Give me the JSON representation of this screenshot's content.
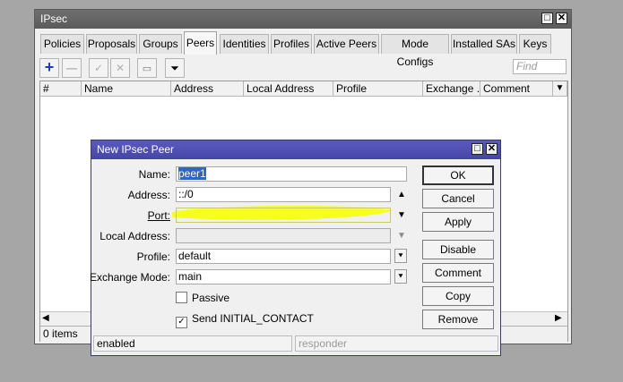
{
  "ipsec_window": {
    "title": "IPsec",
    "tabs": [
      "Policies",
      "Proposals",
      "Groups",
      "Peers",
      "Identities",
      "Profiles",
      "Active Peers",
      "Mode Configs",
      "Installed SAs",
      "Keys"
    ],
    "active_tab": "Peers",
    "find_placeholder": "Find",
    "columns": [
      "#",
      "Name",
      "Address",
      "Local Address",
      "Profile",
      "Exchange ...",
      "Comment"
    ],
    "status": "0 items",
    "toolbar_icons": [
      "plus-icon",
      "minus-icon",
      "check-icon",
      "cross-icon",
      "note-icon",
      "filter-icon"
    ]
  },
  "peer_dialog": {
    "title": "New IPsec Peer",
    "fields": {
      "name": {
        "label": "Name:",
        "value": "peer1"
      },
      "address": {
        "label": "Address:",
        "value": "::/0"
      },
      "port": {
        "label": "Port:",
        "value": ""
      },
      "local_address": {
        "label": "Local Address:",
        "value": ""
      },
      "profile": {
        "label": "Profile:",
        "value": "default"
      },
      "exchange_mode": {
        "label": "Exchange Mode:",
        "value": "main"
      }
    },
    "passive": {
      "label": "Passive",
      "checked": false
    },
    "send_initial_contact": {
      "label": "Send INITIAL_CONTACT",
      "checked": true
    },
    "buttons": {
      "ok": "OK",
      "cancel": "Cancel",
      "apply": "Apply",
      "disable": "Disable",
      "comment": "Comment",
      "copy": "Copy",
      "remove": "Remove"
    },
    "status_left": "enabled",
    "status_right": "responder",
    "highlight_color": "#f6ff1e"
  }
}
